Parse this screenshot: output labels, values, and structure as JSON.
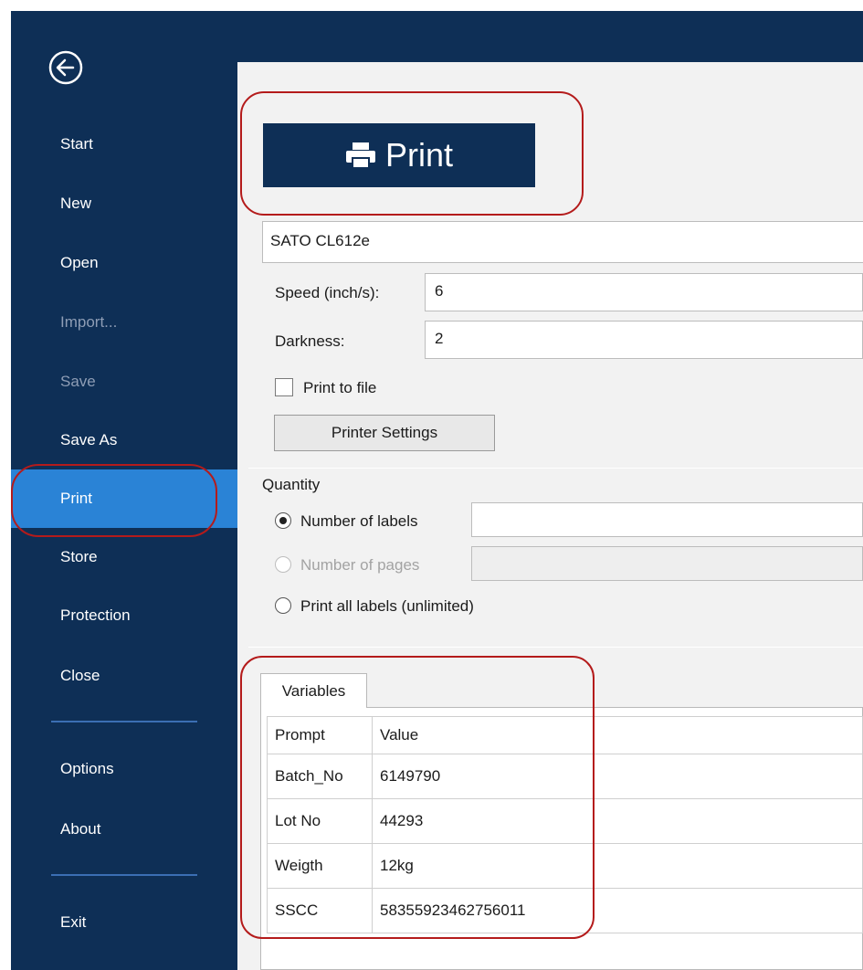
{
  "sidebar": {
    "back_icon": "arrow-left-circle-icon",
    "items": [
      {
        "label": "Start",
        "state": "normal"
      },
      {
        "label": "New",
        "state": "normal"
      },
      {
        "label": "Open",
        "state": "normal"
      },
      {
        "label": "Import...",
        "state": "disabled"
      },
      {
        "label": "Save",
        "state": "disabled"
      },
      {
        "label": "Save As",
        "state": "normal"
      },
      {
        "label": "Print",
        "state": "active"
      },
      {
        "label": "Store",
        "state": "normal"
      },
      {
        "label": "Protection",
        "state": "normal"
      },
      {
        "label": "Close",
        "state": "normal"
      },
      {
        "label": "Options",
        "state": "normal"
      },
      {
        "label": "About",
        "state": "normal"
      },
      {
        "label": "Exit",
        "state": "normal"
      }
    ]
  },
  "print_button": {
    "label": "Print",
    "icon": "printer-icon"
  },
  "printer": {
    "name": "SATO CL612e"
  },
  "settings": {
    "speed_label": "Speed (inch/s):",
    "speed_value": "6",
    "darkness_label": "Darkness:",
    "darkness_value": "2",
    "print_to_file_label": "Print to file",
    "print_to_file_checked": false,
    "printer_settings_label": "Printer Settings"
  },
  "quantity": {
    "title": "Quantity",
    "options": [
      {
        "label": "Number of labels",
        "checked": true,
        "enabled": true
      },
      {
        "label": "Number of pages",
        "checked": false,
        "enabled": false
      },
      {
        "label": "Print all labels (unlimited)",
        "checked": false,
        "enabled": true
      }
    ]
  },
  "variables": {
    "tab_label": "Variables",
    "columns": [
      "Prompt",
      "Value"
    ],
    "rows": [
      {
        "prompt": "Batch_No",
        "value": "6149790"
      },
      {
        "prompt": "Lot No",
        "value": "44293"
      },
      {
        "prompt": "Weigth",
        "value": "12kg"
      },
      {
        "prompt": "SSCC",
        "value": "58355923462756011"
      }
    ]
  },
  "colors": {
    "sidebar_bg": "#0e2f56",
    "sidebar_active": "#2a83d6",
    "annotation": "#b41b1b"
  }
}
